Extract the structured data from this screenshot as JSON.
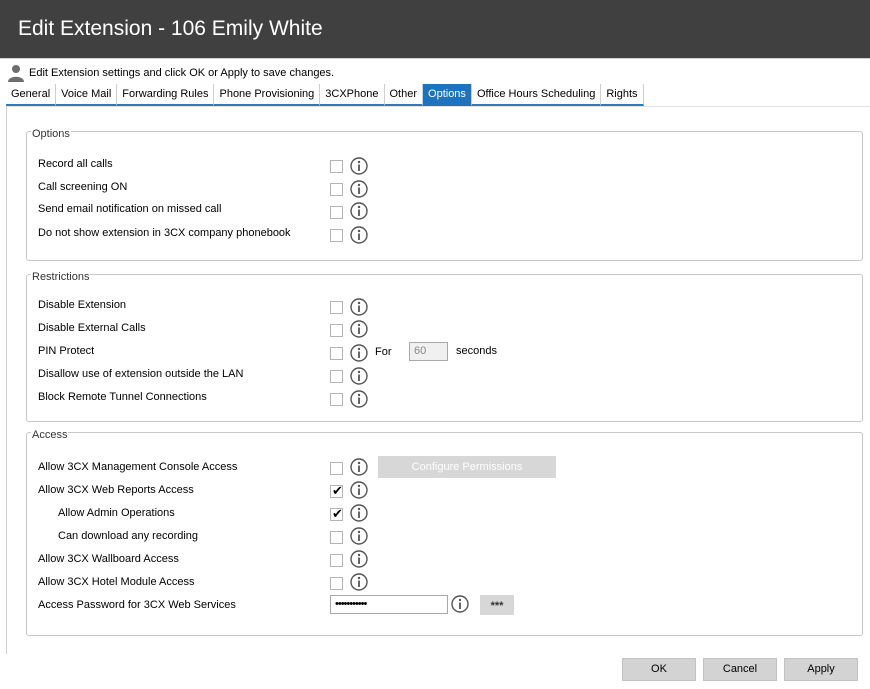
{
  "window": {
    "title": "Edit Extension - 106 Emily White"
  },
  "subheader": {
    "text": "Edit Extension settings and click OK or Apply to save changes."
  },
  "tabs": [
    {
      "label": "General"
    },
    {
      "label": "Voice Mail"
    },
    {
      "label": "Forwarding Rules"
    },
    {
      "label": "Phone Provisioning"
    },
    {
      "label": "3CXPhone"
    },
    {
      "label": "Other"
    },
    {
      "label": "Options"
    },
    {
      "label": "Office Hours Scheduling"
    },
    {
      "label": "Rights"
    }
  ],
  "active_tab": "Options",
  "options": {
    "legend": "Options",
    "items": [
      {
        "label": "Record all calls",
        "checked": false
      },
      {
        "label": "Call screening ON",
        "checked": false
      },
      {
        "label": "Send email notification on missed call",
        "checked": false
      },
      {
        "label": "Do not show extension in 3CX company phonebook",
        "checked": false
      }
    ]
  },
  "restrictions": {
    "legend": "Restrictions",
    "items": [
      {
        "label": "Disable Extension",
        "checked": false
      },
      {
        "label": "Disable External Calls",
        "checked": false
      },
      {
        "label": "PIN Protect",
        "checked": false
      },
      {
        "label": "Disallow use of extension outside the LAN",
        "checked": false
      },
      {
        "label": "Block Remote Tunnel Connections",
        "checked": false
      }
    ],
    "pin_for_label": "For",
    "pin_seconds_value": "60",
    "pin_seconds_unit": "seconds"
  },
  "access": {
    "legend": "Access",
    "items": [
      {
        "label": "Allow 3CX Management Console Access",
        "checked": false
      },
      {
        "label": "Allow 3CX Web Reports Access",
        "checked": true
      },
      {
        "label": "Allow Admin Operations",
        "checked": true
      },
      {
        "label": "Can download any recording",
        "checked": false
      },
      {
        "label": "Allow 3CX Wallboard Access",
        "checked": false
      },
      {
        "label": "Allow 3CX Hotel Module Access",
        "checked": false
      }
    ],
    "configure_permissions_label": "Configure Permissions",
    "password_label": "Access Password for 3CX Web Services",
    "password_value": "•••••••••••",
    "password_reveal_label": "***"
  },
  "footer": {
    "ok": "OK",
    "cancel": "Cancel",
    "apply": "Apply"
  },
  "colors": {
    "titlebar": "#404040",
    "tab_active": "#1e73be",
    "button": "#d3d3d3"
  },
  "icons": {
    "user": "user-icon",
    "info": "info-icon",
    "check": "checkmark-icon"
  }
}
